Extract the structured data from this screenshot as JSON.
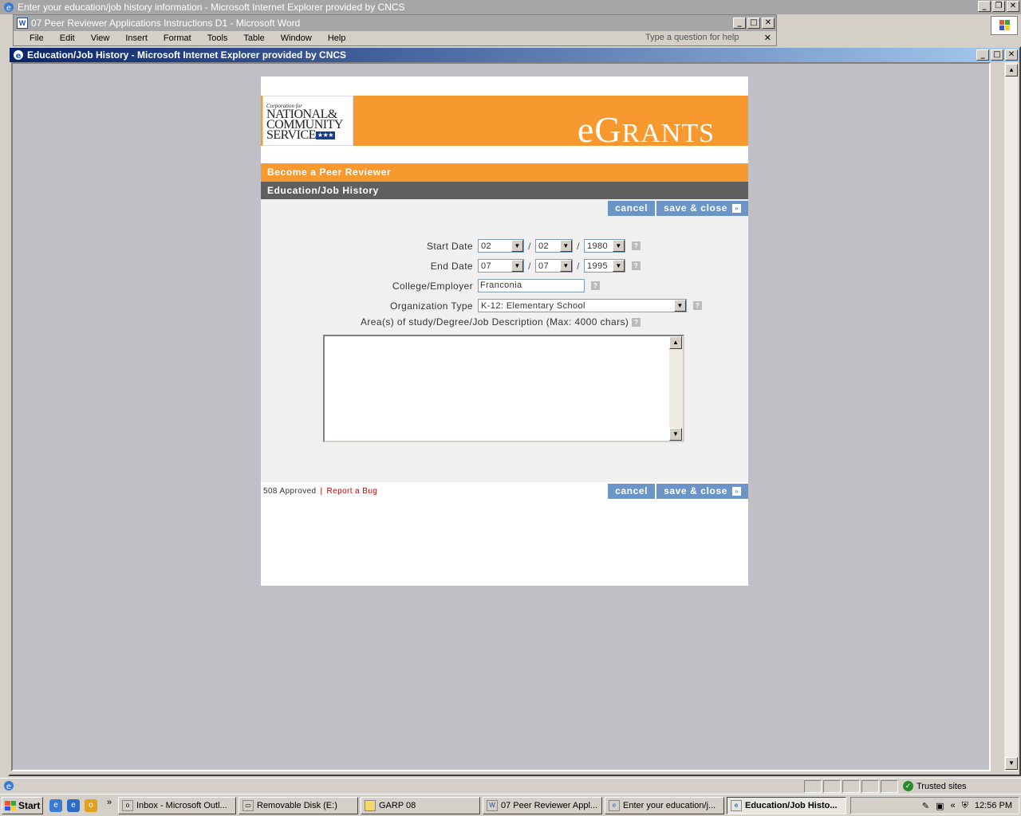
{
  "bg_ie_title": "Enter your education/job history information - Microsoft Internet Explorer provided by CNCS",
  "bg_word_title": "07 Peer Reviewer Applications Instructions D1 - Microsoft Word",
  "word_menu": [
    "File",
    "Edit",
    "View",
    "Insert",
    "Format",
    "Tools",
    "Table",
    "Window",
    "Help"
  ],
  "word_help_placeholder": "Type a question for help",
  "window_title": "Education/Job History - Microsoft Internet Explorer provided by CNCS",
  "logo": {
    "line1": "Corporation for",
    "line2": "NATIONAL&",
    "line3": "COMMUNITY",
    "line4": "SERVICE",
    "stars": "★★★"
  },
  "brand": {
    "e": "e",
    "G": "G",
    "rants": "RANTS"
  },
  "header": {
    "section": "Become a Peer Reviewer",
    "page_title": "Education/Job History"
  },
  "buttons": {
    "cancel": "cancel",
    "save_close": "save & close",
    "arrow": "»"
  },
  "form": {
    "start_label": "Start Date",
    "start_month": "02",
    "start_day": "02",
    "start_year": "1980",
    "end_label": "End Date",
    "end_month": "07",
    "end_day": "07",
    "end_year": "1995",
    "employer_label": "College/Employer",
    "employer_value": "Franconia",
    "org_label": "Organization Type",
    "org_value": "K-12: Elementary School",
    "desc_label": "Area(s) of study/Degree/Job Description (Max: 4000 chars)",
    "desc_value": "",
    "date_sep": "/",
    "help": "?"
  },
  "footer": {
    "approved": "508 Approved",
    "sep": "|",
    "bug": "Report a Bug"
  },
  "status": {
    "zone": "Trusted sites"
  },
  "taskbar": {
    "start": "Start",
    "tasks": [
      "Inbox - Microsoft Outl...",
      "Removable Disk (E:)",
      "GARP 08",
      "07 Peer Reviewer Appl...",
      "Enter your education/j...",
      "Education/Job Histo..."
    ],
    "time": "12:56 PM"
  },
  "colors": {
    "accent_orange": "#f7992f",
    "button_blue": "#6b95c6",
    "bar_gray": "#5f5f5f"
  }
}
